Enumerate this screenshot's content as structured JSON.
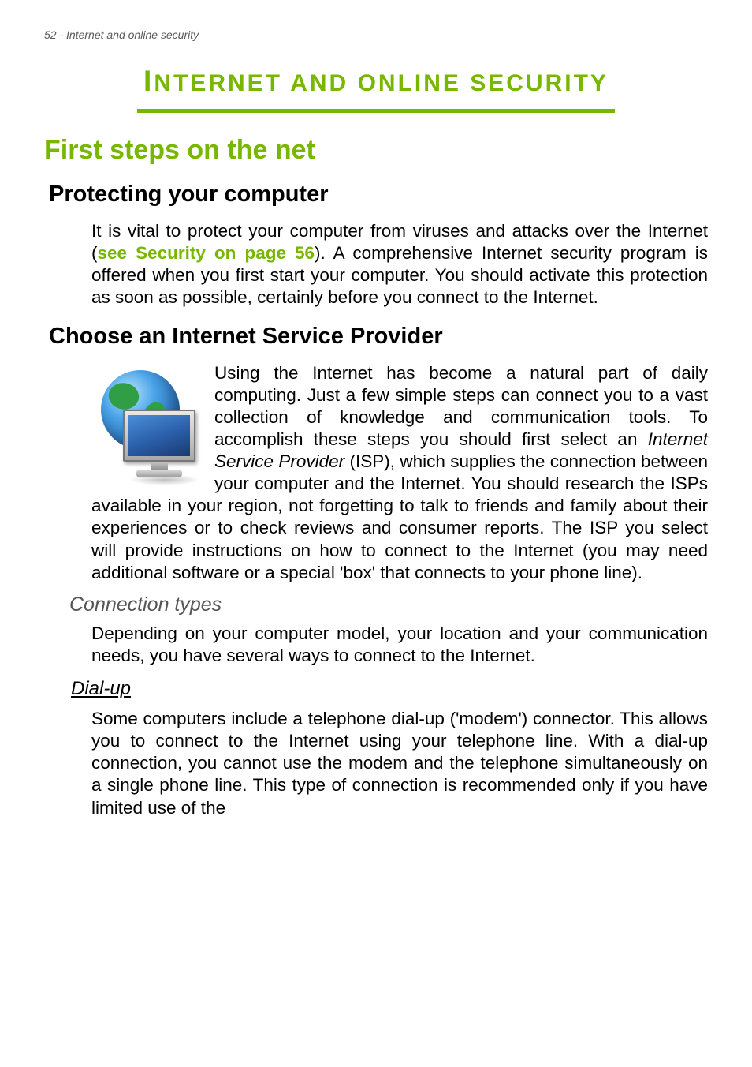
{
  "header": {
    "page_number": "52",
    "section": "Internet and online security"
  },
  "title": {
    "first_big": "I",
    "first_rest": "NTERNET",
    "and": " AND ",
    "second_rest": "ONLINE",
    "third_rest": " SECURITY"
  },
  "h1": "First steps on the net",
  "section_protecting": {
    "heading": "Protecting your computer",
    "p1_a": "It is vital to protect your computer from viruses and attacks over the Internet (",
    "link": "see Security on page 56",
    "p1_b": "). A comprehensive Internet security program is offered when you first start your computer. You should activate this protection as soon as possible, certainly before you connect to the Internet."
  },
  "section_isp": {
    "heading": "Choose an Internet Service Provider",
    "p1_a": "Using the Internet has become a natural part of daily computing. Just a few simple steps can connect you to a vast collection of knowledge and communication tools. To accomplish these steps you should first select an ",
    "isp_italic": "Internet Service Provider",
    "p1_b": " (ISP), which supplies the connection between your computer and the Internet. You should research the ISPs available in your region, not forgetting to talk to friends and family about their experiences or to check reviews and consumer reports. The ISP you select will provide instructions on how to connect to the Internet (you may need additional software or a special 'box' that connects to your phone line)."
  },
  "section_conn": {
    "heading": "Connection types",
    "p1": "Depending on your computer model, your location and your communication needs, you have several ways to connect to the Internet."
  },
  "section_dialup": {
    "heading": "Dial-up",
    "p1": "Some computers include a telephone dial-up ('modem') connector. This allows you to connect to the Internet using your telephone line. With a dial-up connection, you cannot use the modem and the telephone simultaneously on a single phone line. This type of connection is recommended only if you have limited use of the"
  }
}
